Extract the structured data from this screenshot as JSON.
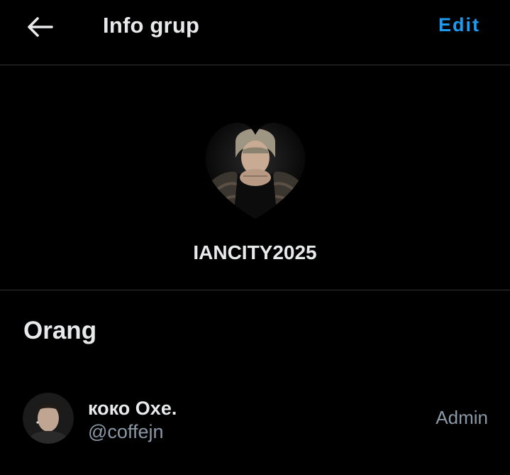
{
  "header": {
    "title": "Info grup",
    "edit_label": "Edit",
    "back_icon": "arrow-left-icon"
  },
  "group": {
    "name": "IANCITY2025",
    "avatar": "group-avatar-photo"
  },
  "people_section": {
    "title": "Orang",
    "members": [
      {
        "display_name": "коко Oxe.",
        "handle": "@coffejn",
        "role": "Admin"
      }
    ]
  },
  "colors": {
    "background": "#000000",
    "text_primary": "#e7e9ea",
    "text_secondary": "#8b98a5",
    "accent": "#1d9bf0",
    "divider": "#2f3336"
  }
}
